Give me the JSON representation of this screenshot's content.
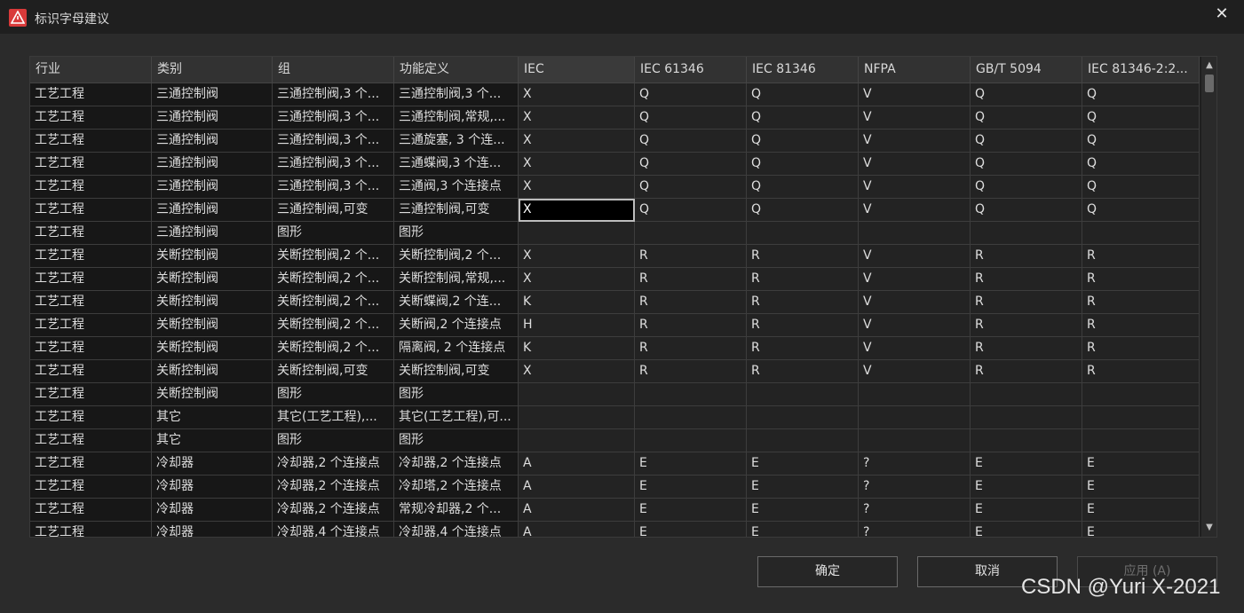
{
  "window": {
    "title": "标识字母建议",
    "close_glyph": "✕"
  },
  "table": {
    "headers": [
      "行业",
      "类别",
      "组",
      "功能定义",
      "IEC",
      "IEC 61346",
      "IEC 81346",
      "NFPA",
      "GB/T 5094",
      "IEC 81346-2:2..."
    ],
    "rows": [
      [
        "工艺工程",
        "三通控制阀",
        "三通控制阀,3 个...",
        "三通控制阀,3 个...",
        "X",
        "Q",
        "Q",
        "V",
        "Q",
        "Q"
      ],
      [
        "工艺工程",
        "三通控制阀",
        "三通控制阀,3 个...",
        "三通控制阀,常规,...",
        "X",
        "Q",
        "Q",
        "V",
        "Q",
        "Q"
      ],
      [
        "工艺工程",
        "三通控制阀",
        "三通控制阀,3 个...",
        "三通旋塞, 3 个连...",
        "X",
        "Q",
        "Q",
        "V",
        "Q",
        "Q"
      ],
      [
        "工艺工程",
        "三通控制阀",
        "三通控制阀,3 个...",
        "三通蝶阀,3 个连...",
        "X",
        "Q",
        "Q",
        "V",
        "Q",
        "Q"
      ],
      [
        "工艺工程",
        "三通控制阀",
        "三通控制阀,3 个...",
        "三通阀,3 个连接点",
        "X",
        "Q",
        "Q",
        "V",
        "Q",
        "Q"
      ],
      [
        "工艺工程",
        "三通控制阀",
        "三通控制阀,可变",
        "三通控制阀,可变",
        "X",
        "Q",
        "Q",
        "V",
        "Q",
        "Q"
      ],
      [
        "工艺工程",
        "三通控制阀",
        "图形",
        "图形",
        "",
        "",
        "",
        "",
        "",
        ""
      ],
      [
        "工艺工程",
        "关断控制阀",
        "关断控制阀,2 个...",
        "关断控制阀,2 个...",
        "X",
        "R",
        "R",
        "V",
        "R",
        "R"
      ],
      [
        "工艺工程",
        "关断控制阀",
        "关断控制阀,2 个...",
        "关断控制阀,常规,...",
        "X",
        "R",
        "R",
        "V",
        "R",
        "R"
      ],
      [
        "工艺工程",
        "关断控制阀",
        "关断控制阀,2 个...",
        "关断蝶阀,2 个连...",
        "K",
        "R",
        "R",
        "V",
        "R",
        "R"
      ],
      [
        "工艺工程",
        "关断控制阀",
        "关断控制阀,2 个...",
        "关断阀,2 个连接点",
        "H",
        "R",
        "R",
        "V",
        "R",
        "R"
      ],
      [
        "工艺工程",
        "关断控制阀",
        "关断控制阀,2 个...",
        "隔离阀, 2 个连接点",
        "K",
        "R",
        "R",
        "V",
        "R",
        "R"
      ],
      [
        "工艺工程",
        "关断控制阀",
        "关断控制阀,可变",
        "关断控制阀,可变",
        "X",
        "R",
        "R",
        "V",
        "R",
        "R"
      ],
      [
        "工艺工程",
        "关断控制阀",
        "图形",
        "图形",
        "",
        "",
        "",
        "",
        "",
        ""
      ],
      [
        "工艺工程",
        "其它",
        "其它(工艺工程),...",
        "其它(工艺工程),可...",
        "",
        "",
        "",
        "",
        "",
        ""
      ],
      [
        "工艺工程",
        "其它",
        "图形",
        "图形",
        "",
        "",
        "",
        "",
        "",
        ""
      ],
      [
        "工艺工程",
        "冷却器",
        "冷却器,2 个连接点",
        "冷却器,2 个连接点",
        "A",
        "E",
        "E",
        "?",
        "E",
        "E"
      ],
      [
        "工艺工程",
        "冷却器",
        "冷却器,2 个连接点",
        "冷却塔,2 个连接点",
        "A",
        "E",
        "E",
        "?",
        "E",
        "E"
      ],
      [
        "工艺工程",
        "冷却器",
        "冷却器,2 个连接点",
        "常规冷却器,2 个...",
        "A",
        "E",
        "E",
        "?",
        "E",
        "E"
      ],
      [
        "工艺工程",
        "冷却器",
        "冷却器,4 个连接点",
        "冷却器,4 个连接点",
        "A",
        "E",
        "E",
        "?",
        "E",
        "E"
      ]
    ],
    "selected": {
      "row": 5,
      "col": 4
    }
  },
  "buttons": {
    "ok": "确定",
    "cancel": "取消",
    "apply": "应用 (A)"
  },
  "watermark": "CSDN @Yuri X-2021",
  "colors": {
    "accent": "#d93a3a",
    "background": "#2b2b2b",
    "grid": "#1f1f1f"
  }
}
